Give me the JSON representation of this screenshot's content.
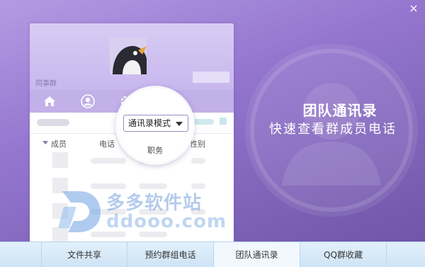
{
  "window": {
    "close_glyph": "×"
  },
  "promo": {
    "title": "团队通讯录",
    "subtitle": "快速查看群成员电话"
  },
  "panel": {
    "group_name": "同事群",
    "tabs": [
      "home-icon",
      "user-icon",
      "gear-icon"
    ],
    "columns": {
      "member": "成员",
      "phone": "电话",
      "gender": "性别"
    }
  },
  "magnifier": {
    "dropdown_value": "通讯录模式",
    "position_label": "职务"
  },
  "watermark": {
    "cn": "多多软件站",
    "en": "ddooo.com"
  },
  "bottom_tabs": [
    {
      "label": "文件共享",
      "active": false
    },
    {
      "label": "预约群组电话",
      "active": false
    },
    {
      "label": "团队通讯录",
      "active": true
    },
    {
      "label": "QQ群收藏",
      "active": false
    }
  ],
  "colors": {
    "accent": "#9476cf",
    "tab_bar": "#cfe4f6"
  }
}
